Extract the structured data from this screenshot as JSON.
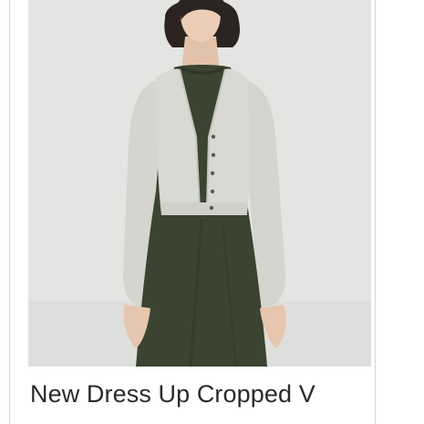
{
  "product": {
    "title": "New Dress Up Cropped V",
    "image_subject": "model-wearing-cropped-v-cardigan-over-olive-dress"
  },
  "colors": {
    "background": "#e3e3e1",
    "cardigan": "#d3d5ce",
    "dress": "#3b4331",
    "hair": "#2b2420",
    "skin": "#e9cbb5"
  }
}
